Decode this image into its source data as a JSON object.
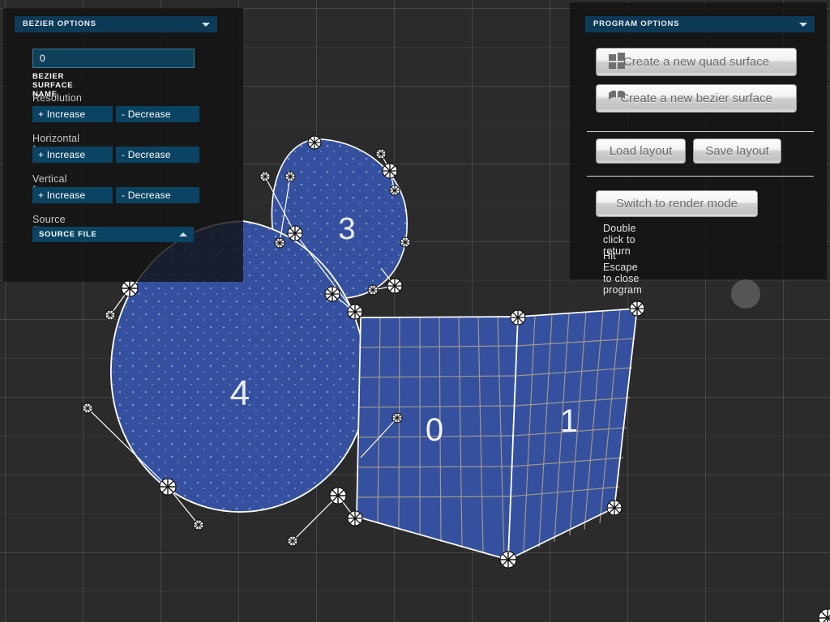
{
  "app": {
    "background_color": "#2b2b2b",
    "surface_fill": "#35509e",
    "accent_blue": "#0b4463",
    "title_bar_color": "#0d3a57"
  },
  "left_panel": {
    "title": "BEZIER OPTIONS",
    "collapse_icon": "chevron-down-icon",
    "surface_name_value": "0",
    "surface_name_caption": "BEZIER SURFACE NAME",
    "groups": [
      {
        "label": "Resolution",
        "increase": "+ Increase",
        "decrease": "- Decrease"
      },
      {
        "label": "Horizontal force",
        "increase": "+ Increase",
        "decrease": "- Decrease"
      },
      {
        "label": "Vertical force",
        "increase": "+ Increase",
        "decrease": "- Decrease"
      }
    ],
    "source_file_label": "Source file",
    "source_file_value": "SOURCE FILE",
    "source_file_icon": "chevron-up-icon"
  },
  "right_panel": {
    "title": "PROGRAM OPTIONS",
    "collapse_icon": "chevron-down-icon",
    "create_quad": "Create a new quad surface",
    "create_quad_icon": "quad-surface-icon",
    "create_bezier": "Create a new bezier surface",
    "create_bezier_icon": "bezier-surface-icon",
    "load_layout": "Load layout",
    "save_layout": "Save layout",
    "switch_render": "Switch to render mode",
    "hint_return": "Double click to return",
    "hint_escape": "Hit Escape to close program"
  },
  "viewport": {
    "surface_labels": [
      "3",
      "4",
      "0",
      "1"
    ],
    "mesh_line_color": "#a0988a",
    "outline_color": "#ffffff",
    "cursor_handle_color": "#5a5a5a"
  }
}
